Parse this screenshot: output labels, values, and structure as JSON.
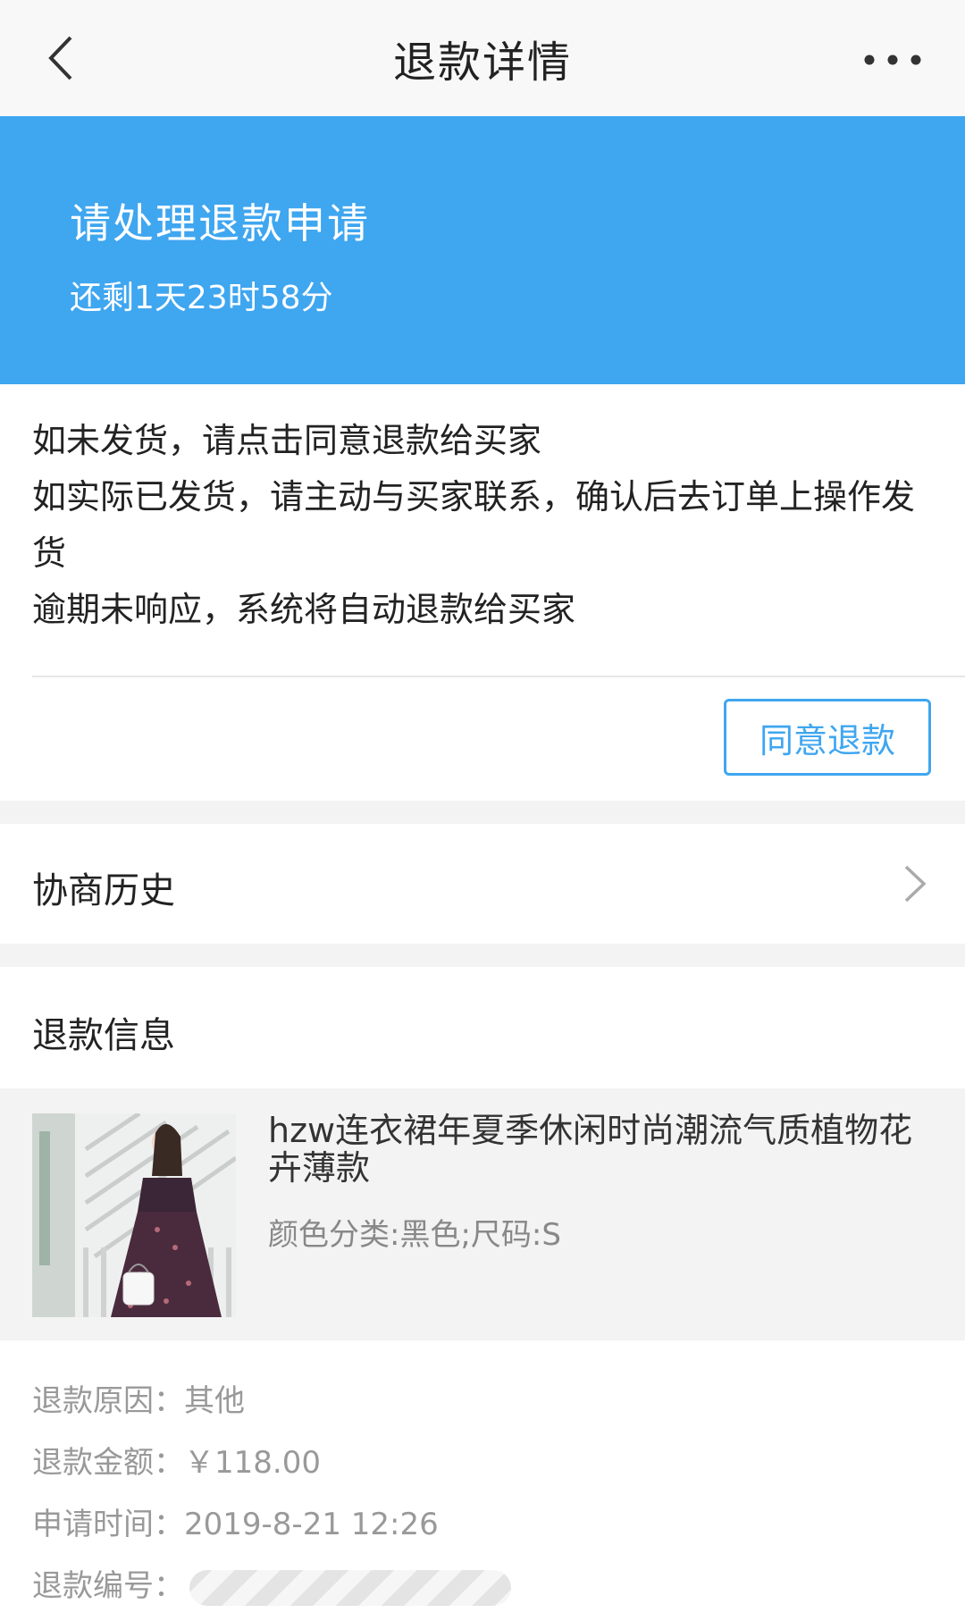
{
  "nav": {
    "back_icon": "chevron-left-icon",
    "title": "退款详情",
    "more_icon": "more-horizontal-icon"
  },
  "banner": {
    "heading": "请处理退款申请",
    "countdown": "还剩1天23时58分",
    "color": "#3fa6f0"
  },
  "notice": {
    "lines": [
      "如未发货，请点击同意退款给买家",
      "如实际已发货，请主动与买家联系，确认后去订单上操作发货",
      "逾期未响应，系统将自动退款给买家"
    ]
  },
  "actions": {
    "agree_label": "同意退款"
  },
  "history": {
    "label": "协商历史",
    "chevron_icon": "chevron-right-icon"
  },
  "refund_info": {
    "title": "退款信息",
    "product": {
      "name": "hzw连衣裙年夏季休闲时尚潮流气质植物花卉薄款",
      "sku": "颜色分类:黑色;尺码:S",
      "image_icon": "product-photo"
    },
    "fields": [
      {
        "label": "退款原因：",
        "value": "其他"
      },
      {
        "label": "退款金额：",
        "value": "￥118.00"
      },
      {
        "label": "申请时间：",
        "value": "2019-8-21 12:26"
      },
      {
        "label": "退款编号：",
        "value": ""
      }
    ]
  }
}
